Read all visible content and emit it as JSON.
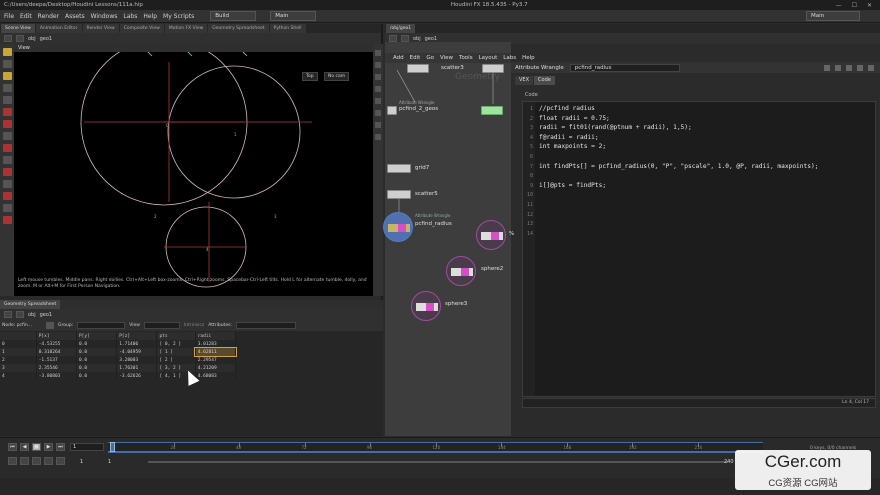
{
  "window": {
    "path": "C:/Users/deepa/Desktop/Houdini Lessons/111a.hip",
    "title": "Houdini FX 18.5.435 - Py3.7",
    "controls": [
      "—",
      "☐",
      "✕"
    ]
  },
  "menu": {
    "items": [
      "File",
      "Edit",
      "Render",
      "Assets",
      "Windows",
      "Labs",
      "Help",
      "My Scripts"
    ],
    "desktop": "Build",
    "context": "Main",
    "right_context": "Main"
  },
  "left_tabs": [
    "Scene View",
    "Animation Editor",
    "Render View",
    "Composite View",
    "Motion FX View",
    "Geometry Spreadsheet",
    "Python Shell"
  ],
  "left_path": {
    "obj": "obj",
    "geo": "geo1"
  },
  "viewport": {
    "label": "View",
    "persp": "Top",
    "cam": "No cam",
    "point_labels": [
      "0",
      "1",
      "2",
      "3",
      "4"
    ],
    "hint": "Left mouse tumbles. Middle pans. Right dollies. Ctrl+Alt+Left box-zooms. Ctrl+Right zooms. Spacebar-Ctrl-Left tilts. Hold L for alternate tumble, dolly, and zoom.    M or Alt+M for First Person Navigation."
  },
  "spreadsheet": {
    "tab": "Geometry Spreadsheet",
    "node": "Node: pcfin...",
    "group_label": "Group:",
    "view_label": "View",
    "intrinsics_label": "Intrinsics",
    "attributes_label": "Attributes:",
    "columns": [
      "",
      "P[x]",
      "P[y]",
      "P[z]",
      "pts",
      "radii"
    ],
    "rows": [
      [
        "0",
        "-4.53255",
        "0.0",
        "1.71406",
        "[ 0, 2 ]",
        "3.01283"
      ],
      [
        "1",
        "0.318264",
        "0.0",
        "-4.04959",
        "[ 1 ]",
        "4.02811"
      ],
      [
        "2",
        "-1.5137",
        "0.0",
        "3.28003",
        "[ 2 ]",
        "2.29547"
      ],
      [
        "3",
        "2.35546",
        "0.0",
        "1.76301",
        "[ 3, 2 ]",
        "4.21209"
      ],
      [
        "4",
        "-3.80803",
        "0.0",
        "-3.62626",
        "[ 4, 1 ]",
        "4.68083"
      ]
    ]
  },
  "network": {
    "tabs": [
      "/obj/geo1"
    ],
    "path": {
      "obj": "obj",
      "geo": "geo1"
    },
    "menu": [
      "Add",
      "Edit",
      "Go",
      "View",
      "Tools",
      "Layout",
      "Labs",
      "Help"
    ],
    "watermark": "Geometry",
    "nodes": [
      {
        "label": "scatter3",
        "cap": ""
      },
      {
        "label": "pcfind_2_geos",
        "cap": "Attribute Wrangle"
      },
      {
        "label": "grid7",
        "cap": ""
      },
      {
        "label": "scatter5",
        "cap": ""
      },
      {
        "label": "pcfind_radius",
        "cap": "Attribute Wrangle"
      },
      {
        "label": "%",
        "cap": ""
      },
      {
        "label": "sphere2",
        "cap": ""
      },
      {
        "label": "sphere3",
        "cap": ""
      }
    ]
  },
  "params": {
    "node_type": "Attribute Wrangle",
    "node_name": "pcfind_radius",
    "tabs": [
      "VEX",
      "Code"
    ],
    "code_label": "Code",
    "cursor": "Ln 4, Col 17",
    "code": [
      "//pcfind radius",
      "float radii = 0.75;",
      "radii = fit01(rand(@ptnum + radii), 1,5);",
      "f@radii = radii;",
      "int maxpoints = 2;",
      "",
      "int findPts[] = pcfind_radius(0, \"P\", \"pscale\", 1.0, @P, radii, maxpoints);",
      "",
      "i[]@pts = findPts;",
      "",
      "",
      "",
      "",
      ""
    ]
  },
  "timeline": {
    "frame": "1",
    "start": "1",
    "end": "1",
    "end_frame": "240",
    "ticks": [
      "24",
      "48",
      "72",
      "96",
      "120",
      "144",
      "168",
      "192",
      "216"
    ],
    "keys_info": "0 keys, 0/0 channels"
  },
  "watermark": {
    "big": "CGer.com",
    "small": "CG资源 CG网站"
  }
}
